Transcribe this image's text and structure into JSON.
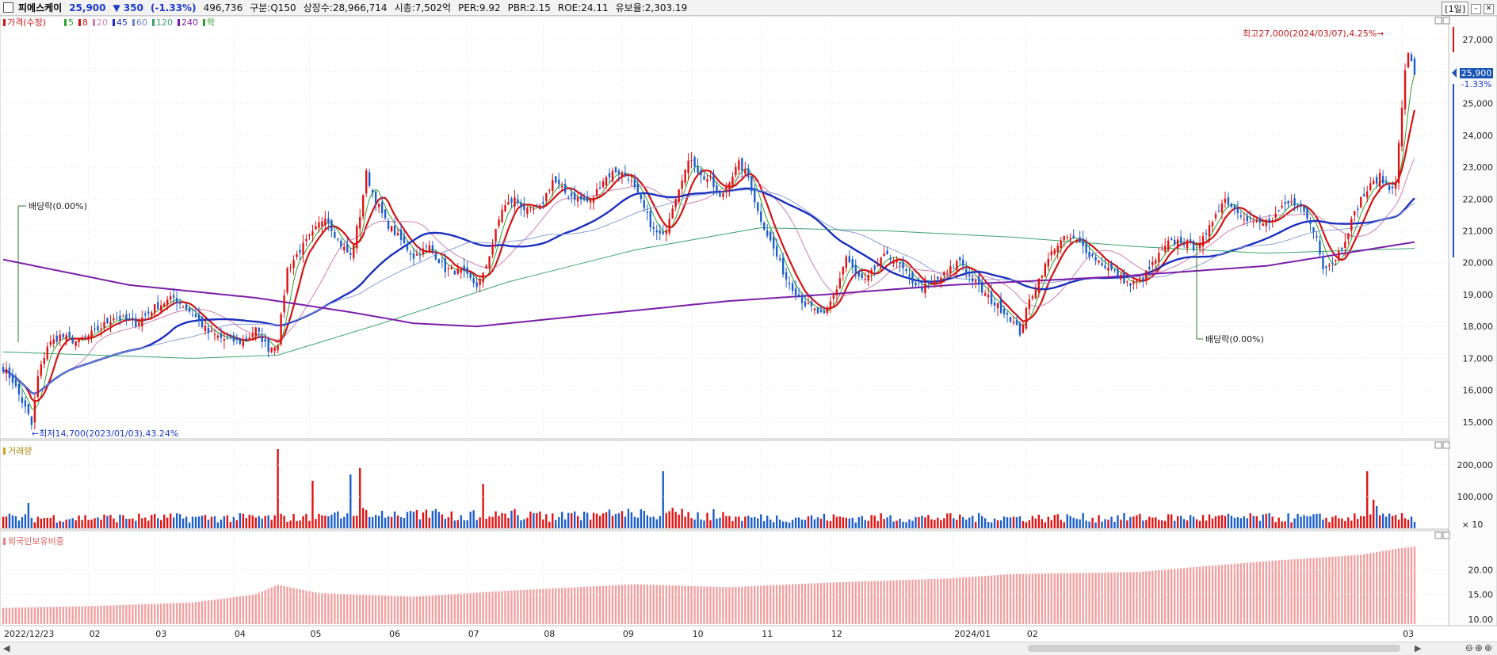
{
  "header": {
    "stock_name": "피에스케이",
    "price": "25,900",
    "change": "▼ 350",
    "change_pct": "(-1.33%)",
    "volume": "496,736",
    "market": "구분:Q150",
    "shares": "상장수:28,966,714",
    "market_cap": "시총:7,502억",
    "per": "PER:9.92",
    "pbr": "PBR:2.15",
    "roe": "ROE:24.11",
    "retention": "유보율:2,303.19",
    "period": "[1일]"
  },
  "price_panel": {
    "legend": [
      {
        "label": "가격(수정)",
        "color": "#d21414"
      },
      {
        "label": "5",
        "color": "#2ca02c"
      },
      {
        "label": "8",
        "color": "#d21414"
      },
      {
        "label": "20",
        "color": "#d07fb0"
      },
      {
        "label": "45",
        "color": "#1a2fbf"
      },
      {
        "label": "60",
        "color": "#6a85c9"
      },
      {
        "label": "120",
        "color": "#3aa36a"
      },
      {
        "label": "240",
        "color": "#7a1ea8"
      },
      {
        "label": "락",
        "color": "#2ca02c"
      }
    ],
    "ticks": [
      "27,000",
      "26,000",
      "25,000",
      "24,000",
      "23,000",
      "22,000",
      "21,000",
      "20,000",
      "19,000",
      "18,000",
      "17,000",
      "16,000",
      "15,000"
    ],
    "current_price_tag": "25,900",
    "current_pct_tag": "-1.33%",
    "annotations": {
      "high": "최고27,000(2024/03/07),4.25%→",
      "low": "←최저14,700(2023/01/03),43.24%",
      "dividend1": "배당락(0.00%)",
      "dividend2": "배당락(0.00%)"
    }
  },
  "volume_panel": {
    "legend": "거래량",
    "ticks": [
      "200,000",
      "100,000"
    ],
    "unit": "× 10"
  },
  "foreign_panel": {
    "legend": "외국인보유비중",
    "ticks": [
      "20.00",
      "15.00",
      "10.00"
    ]
  },
  "x_axis_labels": [
    "2022/12/23",
    "02",
    "03",
    "04",
    "05",
    "06",
    "07",
    "08",
    "09",
    "10",
    "11",
    "12",
    "2024/01",
    "02",
    "03"
  ],
  "chart_data": {
    "type": "candlestick",
    "period": "daily",
    "x_start": "2022/12/23",
    "x_end": "2024/03/08",
    "price_ylim": [
      14500,
      27500
    ],
    "volume_ylim": [
      0,
      250000
    ],
    "foreign_ylim": [
      9,
      28
    ],
    "grid": true,
    "price_key_points": [
      [
        0,
        16700
      ],
      [
        3,
        16300
      ],
      [
        8,
        15200
      ],
      [
        9,
        14900
      ],
      [
        11,
        16400
      ],
      [
        14,
        17400
      ],
      [
        18,
        17700
      ],
      [
        24,
        17500
      ],
      [
        30,
        17900
      ],
      [
        35,
        18300
      ],
      [
        42,
        18100
      ],
      [
        48,
        18600
      ],
      [
        54,
        18900
      ],
      [
        60,
        18400
      ],
      [
        65,
        17800
      ],
      [
        70,
        17600
      ],
      [
        76,
        17500
      ],
      [
        80,
        17900
      ],
      [
        84,
        17300
      ],
      [
        87,
        17500
      ],
      [
        90,
        19800
      ],
      [
        94,
        20400
      ],
      [
        98,
        20900
      ],
      [
        102,
        21500
      ],
      [
        106,
        20700
      ],
      [
        110,
        20200
      ],
      [
        113,
        21500
      ],
      [
        115,
        22800
      ],
      [
        117,
        22200
      ],
      [
        121,
        21300
      ],
      [
        126,
        20700
      ],
      [
        130,
        20200
      ],
      [
        135,
        20500
      ],
      [
        140,
        19800
      ],
      [
        145,
        19700
      ],
      [
        150,
        19300
      ],
      [
        152,
        19600
      ],
      [
        155,
        20600
      ],
      [
        158,
        21700
      ],
      [
        162,
        22000
      ],
      [
        166,
        21600
      ],
      [
        170,
        21700
      ],
      [
        174,
        22600
      ],
      [
        178,
        22200
      ],
      [
        182,
        22000
      ],
      [
        186,
        21900
      ],
      [
        190,
        22600
      ],
      [
        194,
        22900
      ],
      [
        198,
        22700
      ],
      [
        202,
        21900
      ],
      [
        206,
        21000
      ],
      [
        209,
        20800
      ],
      [
        212,
        21800
      ],
      [
        215,
        22700
      ],
      [
        218,
        23300
      ],
      [
        221,
        22700
      ],
      [
        224,
        22600
      ],
      [
        227,
        22000
      ],
      [
        230,
        22600
      ],
      [
        233,
        23100
      ],
      [
        236,
        22700
      ],
      [
        239,
        21600
      ],
      [
        242,
        20900
      ],
      [
        245,
        20200
      ],
      [
        248,
        19500
      ],
      [
        251,
        19100
      ],
      [
        254,
        18700
      ],
      [
        257,
        18500
      ],
      [
        260,
        18300
      ],
      [
        264,
        19200
      ],
      [
        267,
        20200
      ],
      [
        270,
        19600
      ],
      [
        273,
        19400
      ],
      [
        276,
        19800
      ],
      [
        280,
        20300
      ],
      [
        284,
        19900
      ],
      [
        287,
        19500
      ],
      [
        291,
        19200
      ],
      [
        295,
        19400
      ],
      [
        299,
        19700
      ],
      [
        303,
        20100
      ],
      [
        306,
        19600
      ],
      [
        310,
        19100
      ],
      [
        314,
        18700
      ],
      [
        318,
        18400
      ],
      [
        322,
        17800
      ],
      [
        325,
        18800
      ],
      [
        329,
        19700
      ],
      [
        333,
        20500
      ],
      [
        337,
        20800
      ],
      [
        341,
        20600
      ],
      [
        345,
        20200
      ],
      [
        349,
        19900
      ],
      [
        353,
        19600
      ],
      [
        357,
        19300
      ],
      [
        361,
        19500
      ],
      [
        365,
        20100
      ],
      [
        369,
        20600
      ],
      [
        373,
        20700
      ],
      [
        377,
        20500
      ],
      [
        381,
        20800
      ],
      [
        384,
        21600
      ],
      [
        387,
        22000
      ],
      [
        390,
        21700
      ],
      [
        394,
        21400
      ],
      [
        398,
        21200
      ],
      [
        402,
        21300
      ],
      [
        406,
        21800
      ],
      [
        410,
        21900
      ],
      [
        413,
        21400
      ],
      [
        416,
        20800
      ],
      [
        418,
        19900
      ],
      [
        421,
        20000
      ],
      [
        424,
        20500
      ],
      [
        427,
        21300
      ],
      [
        430,
        22000
      ],
      [
        433,
        22400
      ],
      [
        436,
        22700
      ],
      [
        439,
        22300
      ],
      [
        441,
        22600
      ],
      [
        443,
        24800
      ],
      [
        444,
        26100
      ],
      [
        445,
        26500
      ],
      [
        446,
        26250
      ],
      [
        447,
        25900
      ]
    ],
    "ma_periods": [
      5,
      8,
      20,
      45,
      60,
      120,
      240
    ],
    "all_time_high": {
      "value": 27000,
      "date": "2024/03/07",
      "pct": "4.25%"
    },
    "all_time_low": {
      "value": 14700,
      "date": "2023/01/03",
      "pct": "43.24%"
    },
    "last_close": 25900,
    "foreign_key_points": [
      [
        0,
        12.3
      ],
      [
        30,
        12.7
      ],
      [
        60,
        13.4
      ],
      [
        70,
        14.2
      ],
      [
        80,
        15.1
      ],
      [
        87,
        17.0
      ],
      [
        100,
        15.3
      ],
      [
        130,
        14.6
      ],
      [
        160,
        15.8
      ],
      [
        200,
        17.1
      ],
      [
        230,
        16.5
      ],
      [
        260,
        17.4
      ],
      [
        300,
        18.3
      ],
      [
        320,
        19.2
      ],
      [
        360,
        19.6
      ],
      [
        370,
        20.2
      ],
      [
        400,
        21.8
      ],
      [
        430,
        23.1
      ],
      [
        440,
        24.2
      ],
      [
        447,
        24.8
      ]
    ]
  }
}
